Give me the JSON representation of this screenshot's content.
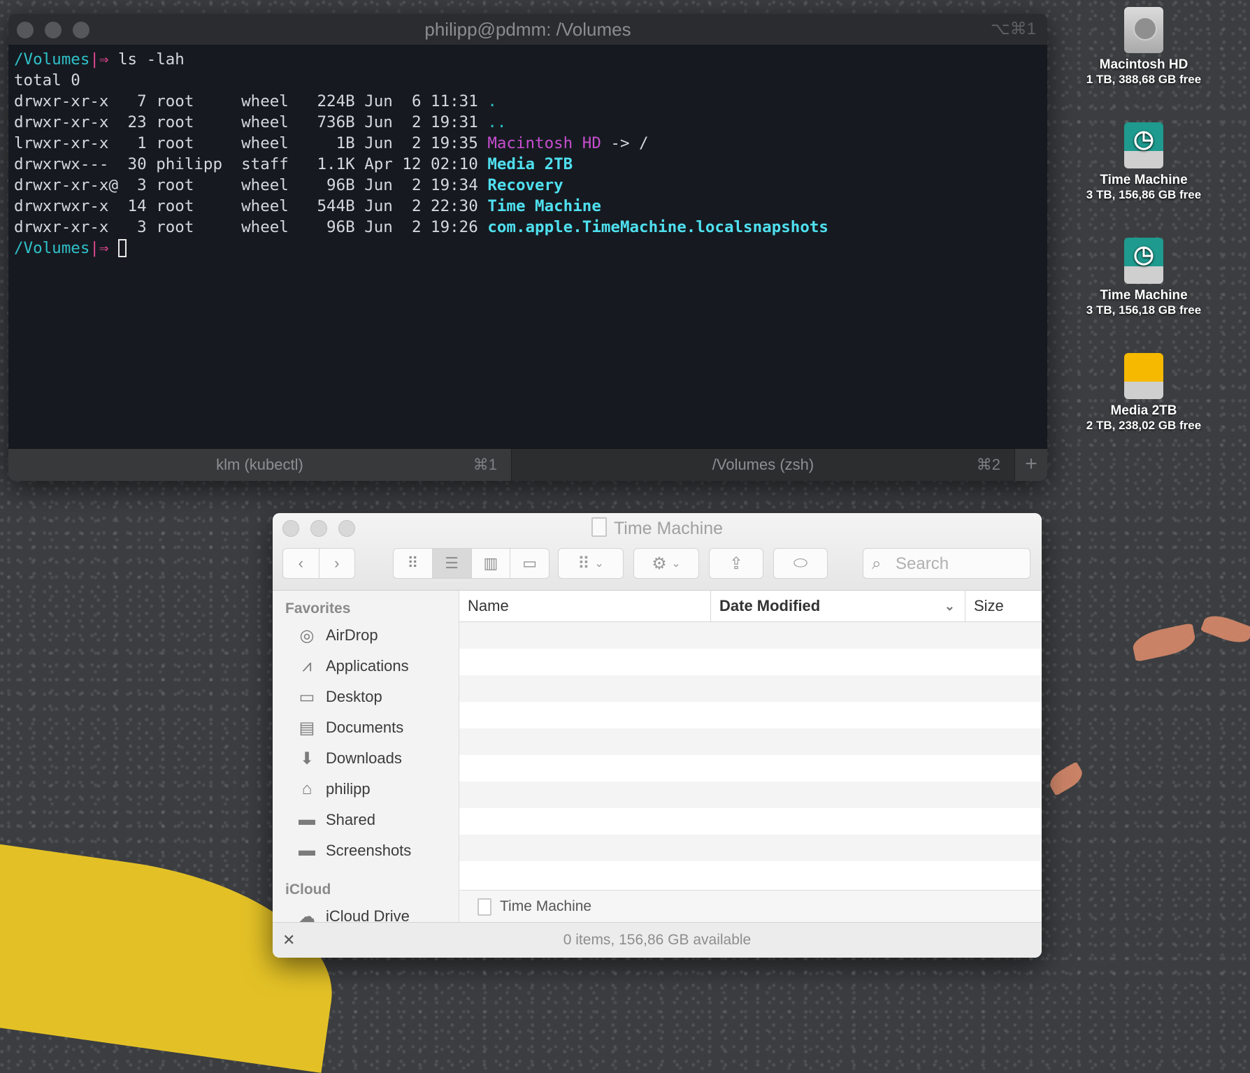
{
  "terminal": {
    "title": "philipp@pdmm: /Volumes",
    "title_shortcut": "⌥⌘1",
    "prompt_path": "/Volumes",
    "prompt_sep": "|⇒",
    "command": "ls -lah",
    "total_line": "total 0",
    "listing": [
      {
        "meta": "drwxr-xr-x   7 root     wheel   224B Jun  6 11:31 ",
        "name": ".",
        "suffix": "",
        "style": "cyan"
      },
      {
        "meta": "drwxr-xr-x  23 root     wheel   736B Jun  2 19:31 ",
        "name": "..",
        "suffix": "",
        "style": "cyan"
      },
      {
        "meta": "lrwxr-xr-x   1 root     wheel     1B Jun  2 19:35 ",
        "name": "Macintosh HD",
        "suffix": " -> /",
        "style": "pink"
      },
      {
        "meta": "drwxrwx---  30 philipp  staff   1.1K Apr 12 02:10 ",
        "name": "Media 2TB",
        "suffix": "",
        "style": "bcyan"
      },
      {
        "meta": "drwxr-xr-x@  3 root     wheel    96B Jun  2 19:34 ",
        "name": "Recovery",
        "suffix": "",
        "style": "bcyan"
      },
      {
        "meta": "drwxrwxr-x  14 root     wheel   544B Jun  2 22:30 ",
        "name": "Time Machine",
        "suffix": "",
        "style": "bcyan"
      },
      {
        "meta": "drwxr-xr-x   3 root     wheel    96B Jun  2 19:26 ",
        "name": "com.apple.TimeMachine.localsnapshots",
        "suffix": "",
        "style": "bcyan"
      }
    ],
    "tabs": [
      {
        "label": "klm (kubectl)",
        "shortcut": "⌘1"
      },
      {
        "label": "/Volumes (zsh)",
        "shortcut": "⌘2"
      }
    ],
    "add_tab": "+"
  },
  "desktop": {
    "icons": [
      {
        "name": "Macintosh HD",
        "info": "1 TB, 388,68 GB free",
        "kind": "hd"
      },
      {
        "name": "Time Machine",
        "info": "3 TB, 156,86 GB free",
        "kind": "tm"
      },
      {
        "name": "Time Machine",
        "info": "3 TB, 156,18 GB free",
        "kind": "tm"
      },
      {
        "name": "Media 2TB",
        "info": "2 TB, 238,02 GB free",
        "kind": "ext"
      }
    ]
  },
  "finder": {
    "title": "Time Machine",
    "search_placeholder": "Search",
    "sidebar": {
      "favorites_label": "Favorites",
      "favorites": [
        {
          "label": "AirDrop",
          "icon": "airdrop-icon"
        },
        {
          "label": "Applications",
          "icon": "applications-icon"
        },
        {
          "label": "Desktop",
          "icon": "desktop-icon"
        },
        {
          "label": "Documents",
          "icon": "documents-icon"
        },
        {
          "label": "Downloads",
          "icon": "downloads-icon"
        },
        {
          "label": "philipp",
          "icon": "home-icon"
        },
        {
          "label": "Shared",
          "icon": "folder-icon"
        },
        {
          "label": "Screenshots",
          "icon": "folder-icon"
        }
      ],
      "icloud_label": "iCloud",
      "icloud": [
        {
          "label": "iCloud Drive",
          "icon": "cloud-icon"
        }
      ]
    },
    "columns": {
      "name": "Name",
      "date": "Date Modified",
      "size": "Size"
    },
    "path_item": "Time Machine",
    "status": "0 items, 156,86 GB available"
  }
}
